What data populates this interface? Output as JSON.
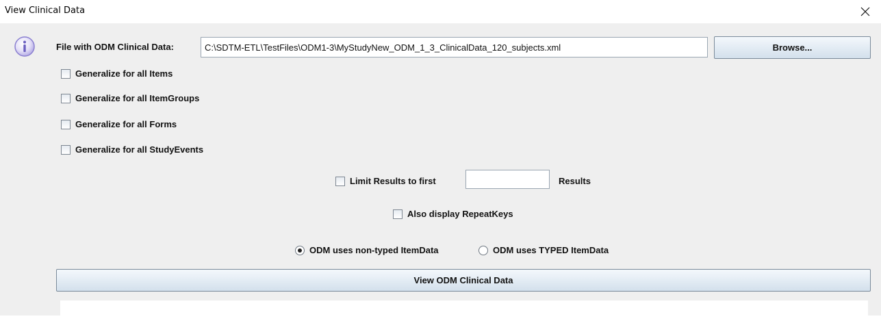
{
  "window": {
    "title": "View Clinical Data"
  },
  "file": {
    "label": "File with ODM Clinical Data:",
    "value": "C:\\SDTM-ETL\\TestFiles\\ODM1-3\\MyStudyNew_ODM_1_3_ClinicalData_120_subjects.xml",
    "browse_label": "Browse..."
  },
  "options": {
    "generalize_items": "Generalize for all Items",
    "generalize_itemgroups": "Generalize for all ItemGroups",
    "generalize_forms": "Generalize for all Forms",
    "generalize_studyevents": "Generalize for all StudyEvents"
  },
  "limit": {
    "label": "Limit Results to first",
    "value": "",
    "suffix": "Results"
  },
  "repeatkeys_label": "Also display RepeatKeys",
  "itemdata_type": {
    "non_typed": "ODM uses non-typed ItemData",
    "typed": "ODM uses TYPED ItemData",
    "selected": "non_typed"
  },
  "view_button_label": "View ODM Clinical Data",
  "colors": {
    "button_top": "#f4f8fc",
    "button_bottom": "#d3e0ec",
    "info_icon": "#8a7fd0"
  },
  "icons": [
    "info-icon",
    "close-icon"
  ]
}
